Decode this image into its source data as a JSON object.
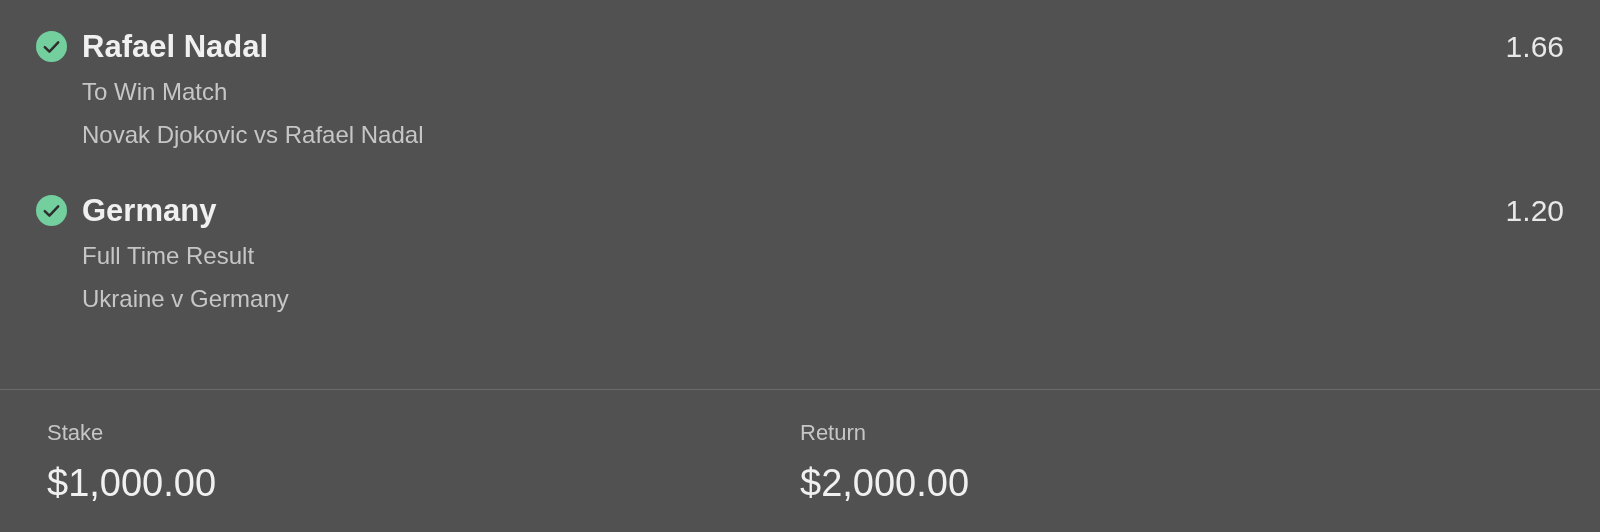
{
  "selections": [
    {
      "won": true,
      "name": "Rafael Nadal",
      "odds": "1.66",
      "market": "To Win Match",
      "event": "Novak Djokovic vs Rafael Nadal"
    },
    {
      "won": true,
      "name": "Germany",
      "odds": "1.20",
      "market": "Full Time Result",
      "event": "Ukraine v Germany"
    }
  ],
  "totals": [
    {
      "label": "Stake",
      "value": "$1,000.00"
    },
    {
      "label": "Return",
      "value": "$2,000.00"
    }
  ]
}
